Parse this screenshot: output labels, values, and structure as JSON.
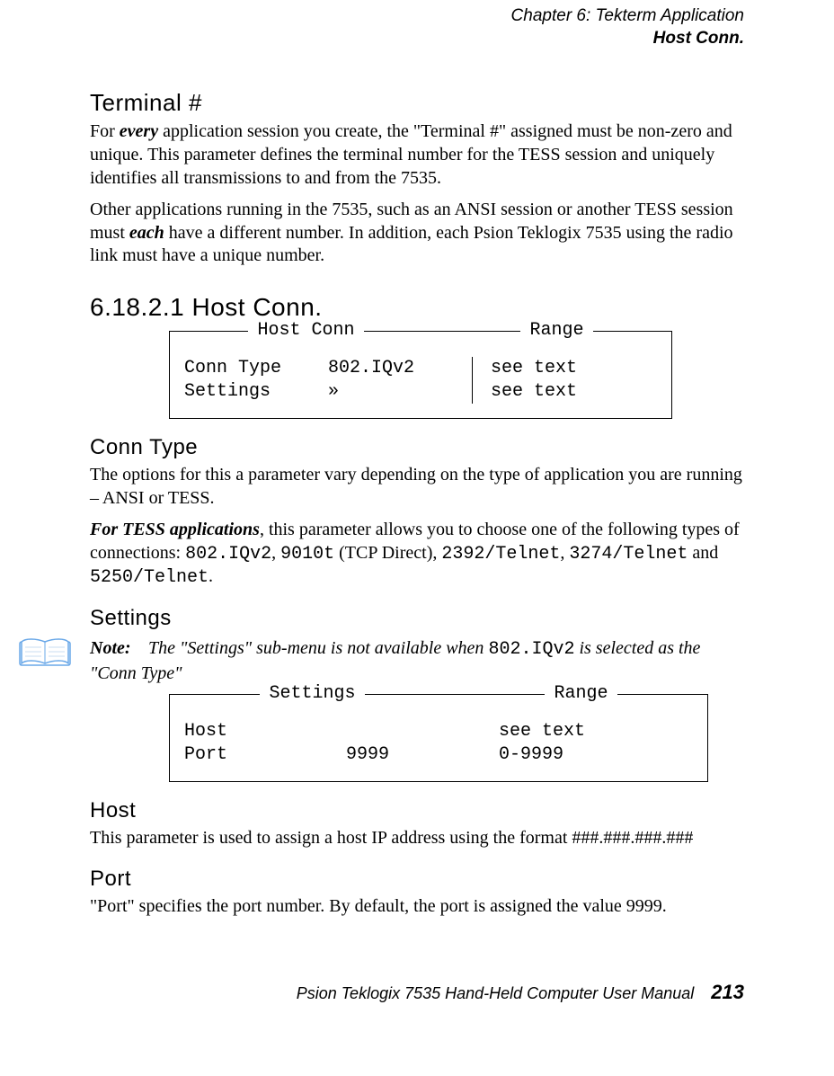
{
  "header": {
    "chapter": "Chapter 6: Tekterm Application",
    "section": "Host Conn."
  },
  "terminal": {
    "heading": "Terminal #",
    "p1_a": "For ",
    "p1_em": "every",
    "p1_b": " application session you create, the \"Terminal #\" assigned must be non-zero and unique. This parameter defines the terminal number for the TESS session and uniquely identifies all transmissions to and from the 7535.",
    "p2_a": "Other applications running in the 7535, such as an ANSI session or another TESS session must ",
    "p2_em": "each",
    "p2_b": " have a different number. In addition, each Psion Teklogix 7535 using the radio link must have a unique number."
  },
  "host_conn": {
    "heading": "6.18.2.1 Host Conn.",
    "box": {
      "legend_left": "Host Conn",
      "legend_right": "Range",
      "rows": [
        {
          "c1": "Conn Type",
          "c2": "802.IQv2",
          "c3": "see text"
        },
        {
          "c1": "Settings",
          "c2": "»",
          "c3": "see text"
        }
      ]
    }
  },
  "conn_type": {
    "heading": "Conn Type",
    "p1": "The options for this a parameter vary depending on the type of application you are running – ANSI or TESS.",
    "p2_em": "For TESS applications",
    "p2_a": ", this parameter allows you to choose one of the following types of connections: ",
    "p2_m1": "802.IQv2",
    "p2_b": ", ",
    "p2_m2": "9010t",
    "p2_c": " (TCP Direct), ",
    "p2_m3": "2392/Telnet",
    "p2_d": ", ",
    "p2_m4": "3274/Telnet",
    "p2_e": " and ",
    "p2_m5": "5250/Telnet",
    "p2_f": "."
  },
  "settings": {
    "heading": "Settings",
    "note_label": "Note:",
    "note_a": "The \"Settings\" sub-menu is not available when ",
    "note_m": "802.IQv2",
    "note_b": " is selected as the \"Conn Type\"",
    "box": {
      "legend_left": "Settings",
      "legend_right": "Range",
      "rows": [
        {
          "c1": "Host",
          "c2": "",
          "c3": "see text"
        },
        {
          "c1": "Port",
          "c2": "9999",
          "c3": "0-9999"
        }
      ]
    }
  },
  "host": {
    "heading": "Host",
    "p": "This parameter is used to assign a host IP address using the format ###.###.###.###"
  },
  "port": {
    "heading": "Port",
    "p": "\"Port\" specifies the port number. By default, the port is assigned the value 9999."
  },
  "footer": {
    "title": "Psion Teklogix 7535 Hand-Held Computer User Manual",
    "page": "213"
  }
}
